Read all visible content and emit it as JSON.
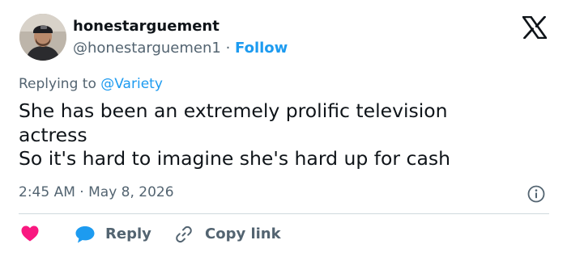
{
  "author": {
    "display_name": "honestarguement",
    "handle": "@honestarguemen1",
    "separator": " · ",
    "follow_label": "Follow",
    "avatar_icon": "user-avatar"
  },
  "brand": {
    "logo_icon": "x-logo-icon",
    "color": "#0f1419"
  },
  "reply_context": {
    "prefix": "Replying to ",
    "mention": "@Variety"
  },
  "tweet": {
    "lines": [
      "She has been an extremely prolific television",
      "actress",
      "So it's hard to imagine she's hard up for cash"
    ]
  },
  "meta": {
    "time": "2:45 AM",
    "separator": " · ",
    "date": "May 8, 2026",
    "info_icon": "info-icon"
  },
  "actions": {
    "like_icon": "heart-icon",
    "reply_label": "Reply",
    "reply_icon": "speech-bubble-icon",
    "copy_label": "Copy link",
    "copy_icon": "link-icon"
  },
  "colors": {
    "accent": "#1d9bf0",
    "like": "#f91880",
    "muted_text": "#536471",
    "divider": "#cfd9de"
  }
}
